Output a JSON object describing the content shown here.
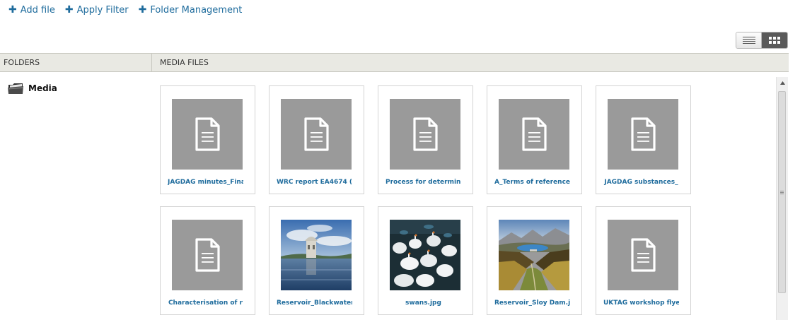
{
  "toolbar": {
    "add_file": "Add file",
    "apply_filter": "Apply Filter",
    "folder_management": "Folder Management"
  },
  "headers": {
    "folders": "FOLDERS",
    "media_files": "MEDIA FILES"
  },
  "folders": [
    {
      "name": "Media",
      "icon": "folder-icon"
    }
  ],
  "view_mode": "grid",
  "colors": {
    "link": "#1f6c9d",
    "header_bg": "#e9e9e3",
    "placeholder_bg": "#9a9a9a",
    "toggle_active": "#5a5a5a"
  },
  "media_files": [
    {
      "label": "JAGDAG minutes_Final",
      "type": "document",
      "icon": "document-icon"
    },
    {
      "label": "WRC report EA4674 (",
      "type": "document",
      "icon": "document-icon"
    },
    {
      "label": "Process for determining",
      "type": "document",
      "icon": "document-icon"
    },
    {
      "label": "A_Terms of reference",
      "type": "document",
      "icon": "document-icon"
    },
    {
      "label": "JAGDAG substances_",
      "type": "document",
      "icon": "document-icon"
    },
    {
      "label": "Characterisation of r",
      "type": "document",
      "icon": "document-icon"
    },
    {
      "label": "Reservoir_Blackwater",
      "type": "image",
      "icon": "reservoir-tower-photo"
    },
    {
      "label": "swans.jpg",
      "type": "image",
      "icon": "swans-photo"
    },
    {
      "label": "Reservoir_Sloy Dam.j",
      "type": "image",
      "icon": "dam-valley-photo"
    },
    {
      "label": "UKTAG workshop flye",
      "type": "document",
      "icon": "document-icon"
    }
  ]
}
